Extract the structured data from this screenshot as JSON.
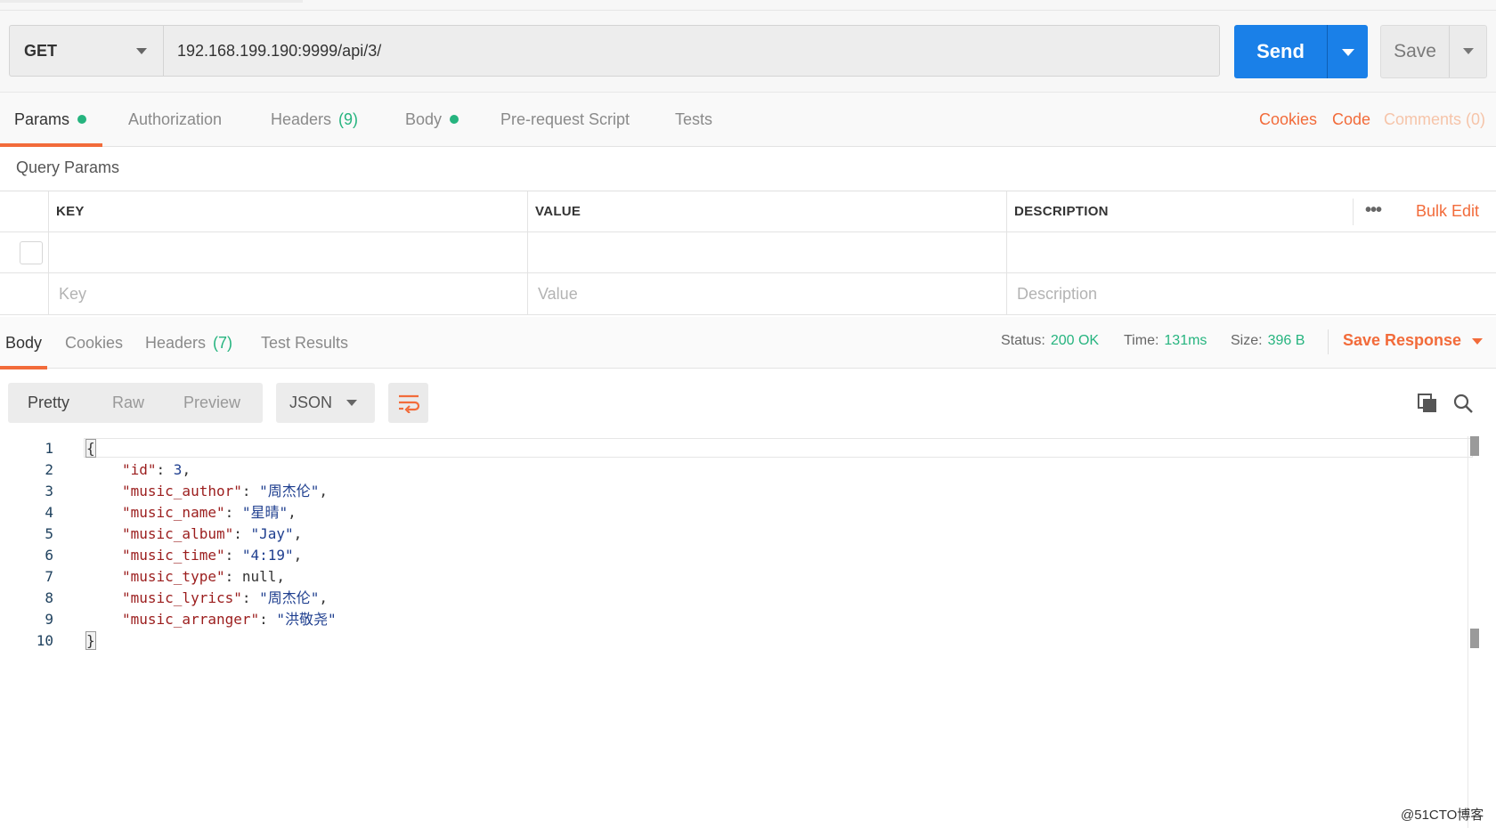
{
  "request": {
    "method": "GET",
    "url": "192.168.199.190:9999/api/3/",
    "send_label": "Send",
    "save_label": "Save"
  },
  "request_tabs": {
    "params": "Params",
    "authorization": "Authorization",
    "headers": "Headers",
    "headers_count": "(9)",
    "body": "Body",
    "pre_request": "Pre-request Script",
    "tests": "Tests",
    "cookies": "Cookies",
    "code": "Code",
    "comments": "Comments (0)"
  },
  "query_params": {
    "title": "Query Params",
    "columns": [
      "KEY",
      "VALUE",
      "DESCRIPTION"
    ],
    "bulk_edit": "Bulk Edit",
    "placeholders": {
      "key": "Key",
      "value": "Value",
      "description": "Description"
    }
  },
  "response_tabs": {
    "body": "Body",
    "cookies": "Cookies",
    "headers": "Headers",
    "headers_count": "(7)",
    "test_results": "Test Results"
  },
  "response_status": {
    "status_label": "Status:",
    "status": "200 OK",
    "time_label": "Time:",
    "time": "131ms",
    "size_label": "Size:",
    "size": "396 B",
    "save_response": "Save Response"
  },
  "response_toolbar": {
    "pretty": "Pretty",
    "raw": "Raw",
    "preview": "Preview",
    "format": "JSON"
  },
  "response_body": {
    "open": "{",
    "close": "}",
    "fields": [
      {
        "key": "\"id\"",
        "value": "3",
        "type": "number",
        "comma": ","
      },
      {
        "key": "\"music_author\"",
        "value": "\"周杰伦\"",
        "type": "string",
        "comma": ","
      },
      {
        "key": "\"music_name\"",
        "value": "\"星晴\"",
        "type": "string",
        "comma": ","
      },
      {
        "key": "\"music_album\"",
        "value": "\"Jay\"",
        "type": "string",
        "comma": ","
      },
      {
        "key": "\"music_time\"",
        "value": "\"4:19\"",
        "type": "string",
        "comma": ","
      },
      {
        "key": "\"music_type\"",
        "value": "null",
        "type": "null",
        "comma": ","
      },
      {
        "key": "\"music_lyrics\"",
        "value": "\"周杰伦\"",
        "type": "string",
        "comma": ","
      },
      {
        "key": "\"music_arranger\"",
        "value": "\"洪敬尧\"",
        "type": "string",
        "comma": ""
      }
    ],
    "line_numbers": [
      "1",
      "2",
      "3",
      "4",
      "5",
      "6",
      "7",
      "8",
      "9",
      "10"
    ]
  },
  "watermark": "@51CTO博客",
  "colors": {
    "accent": "#f26b3a",
    "send": "#1a80e8",
    "status_green": "#26b47f"
  },
  "icons": [
    "chevron-down-icon",
    "more-dots-icon",
    "wrap-lines-icon",
    "copy-icon",
    "search-icon"
  ]
}
